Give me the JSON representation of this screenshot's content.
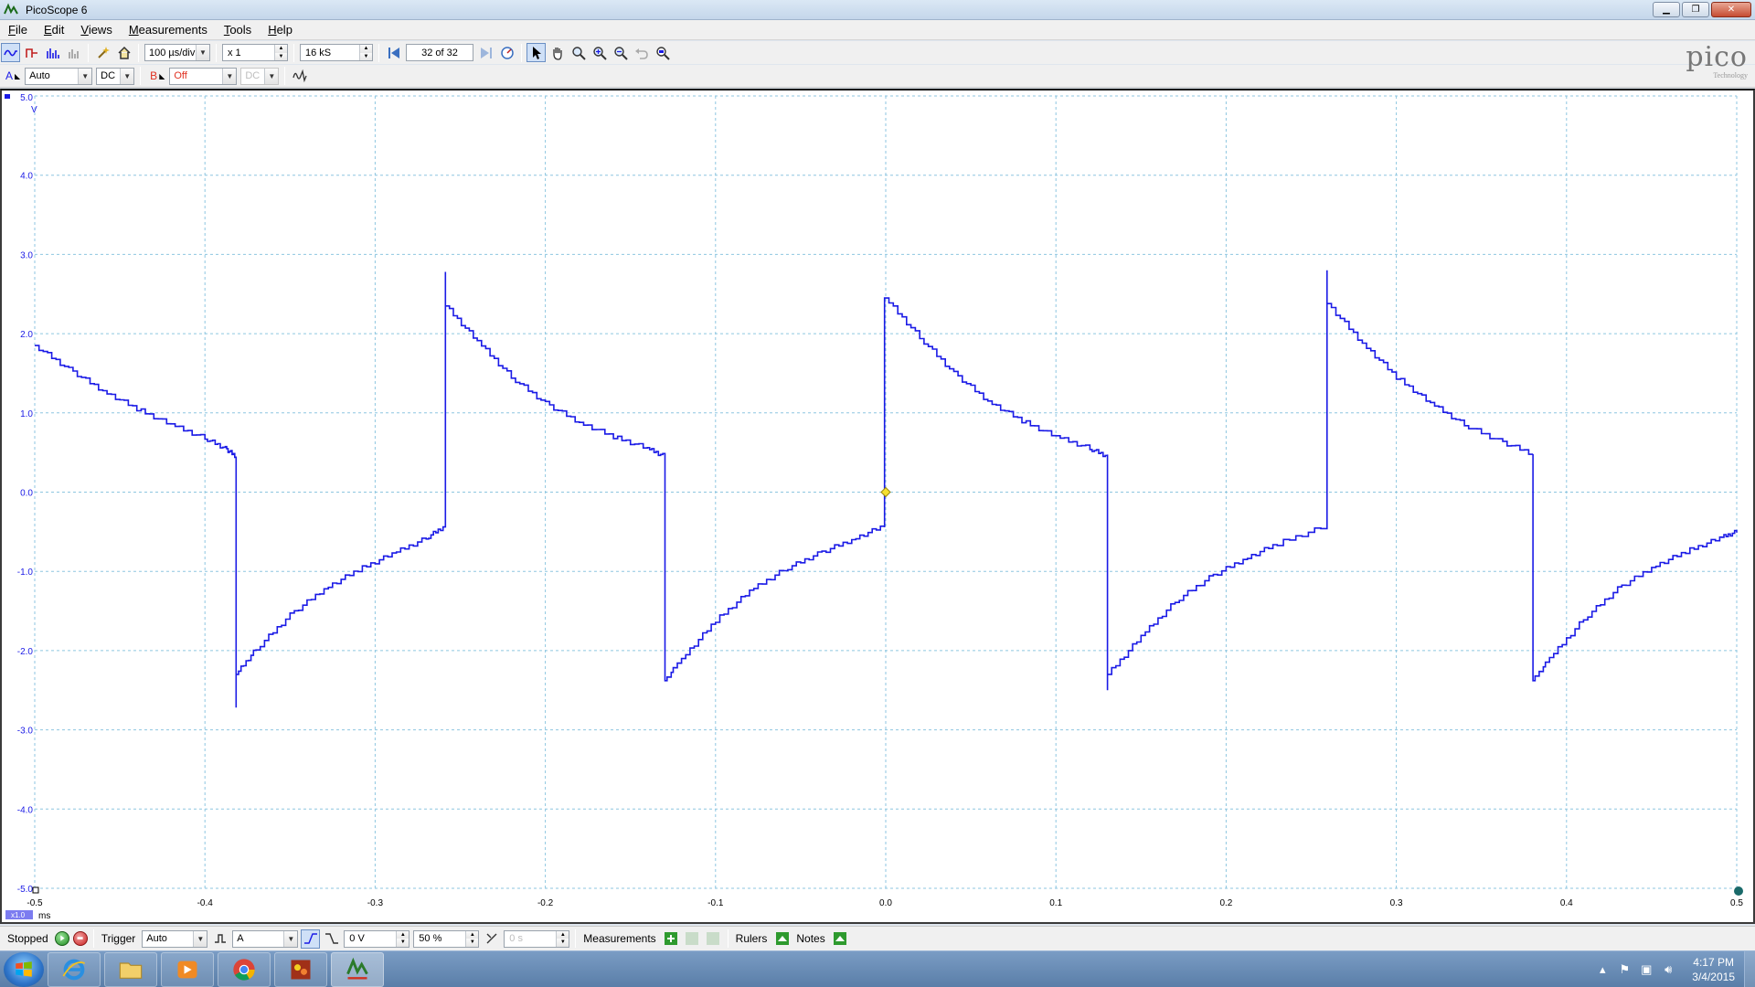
{
  "window": {
    "title": "PicoScope 6"
  },
  "menu": [
    {
      "key": "F",
      "rest": "ile"
    },
    {
      "key": "E",
      "rest": "dit"
    },
    {
      "key": "V",
      "rest": "iews"
    },
    {
      "key": "M",
      "rest": "easurements"
    },
    {
      "key": "T",
      "rest": "ools"
    },
    {
      "key": "H",
      "rest": "elp"
    }
  ],
  "toolbar": {
    "timebase": "100 µs/div",
    "zoom": "x 1",
    "samples": "16 kS",
    "buffer": "32 of 32"
  },
  "channels": {
    "a": {
      "label": "A",
      "range": "Auto",
      "coupling": "DC",
      "color": "#1a1ae6"
    },
    "b": {
      "label": "B",
      "range": "Off",
      "coupling": "DC",
      "color": "#e03020"
    }
  },
  "logo": {
    "word": "pico",
    "sub": "Technology"
  },
  "axes": {
    "y_unit": "V",
    "x_unit": "ms",
    "x_zoom": "x1.0",
    "y_ticks": [
      "5.0",
      "4.0",
      "3.0",
      "2.0",
      "1.0",
      "0.0",
      "-1.0",
      "-2.0",
      "-3.0",
      "-4.0",
      "-5.0"
    ],
    "x_ticks": [
      "-0.5",
      "-0.4",
      "-0.3",
      "-0.2",
      "-0.1",
      "0.0",
      "0.1",
      "0.2",
      "0.3",
      "0.4",
      "0.5"
    ]
  },
  "chart_data": {
    "type": "line",
    "xlabel": "ms",
    "ylabel": "V",
    "xlim": [
      -0.5,
      0.5
    ],
    "ylim": [
      -5.0,
      5.0
    ],
    "grid": true,
    "series": [
      {
        "name": "A",
        "color": "#1a1ae6",
        "points": [
          [
            -0.5,
            1.85
          ],
          [
            -0.48,
            1.55
          ],
          [
            -0.46,
            1.28
          ],
          [
            -0.44,
            1.05
          ],
          [
            -0.42,
            0.85
          ],
          [
            -0.4,
            0.68
          ],
          [
            -0.388,
            0.55
          ],
          [
            -0.3817,
            0.45
          ],
          [
            -0.3817,
            -2.72
          ],
          [
            -0.3817,
            -2.3
          ],
          [
            -0.37,
            -1.98
          ],
          [
            -0.35,
            -1.55
          ],
          [
            -0.33,
            -1.22
          ],
          [
            -0.31,
            -0.98
          ],
          [
            -0.29,
            -0.78
          ],
          [
            -0.27,
            -0.58
          ],
          [
            -0.2587,
            -0.42
          ],
          [
            -0.2587,
            2.78
          ],
          [
            -0.2587,
            2.35
          ],
          [
            -0.24,
            1.9
          ],
          [
            -0.22,
            1.45
          ],
          [
            -0.2,
            1.12
          ],
          [
            -0.18,
            0.88
          ],
          [
            -0.16,
            0.7
          ],
          [
            -0.14,
            0.55
          ],
          [
            -0.1297,
            0.45
          ],
          [
            -0.1297,
            -2.38
          ],
          [
            -0.12,
            -2.1
          ],
          [
            -0.1,
            -1.62
          ],
          [
            -0.08,
            -1.25
          ],
          [
            -0.06,
            -0.98
          ],
          [
            -0.04,
            -0.78
          ],
          [
            -0.02,
            -0.6
          ],
          [
            -0.0007,
            -0.42
          ],
          [
            -0.0007,
            2.45
          ],
          [
            0.02,
            1.95
          ],
          [
            0.04,
            1.5
          ],
          [
            0.06,
            1.15
          ],
          [
            0.08,
            0.9
          ],
          [
            0.1,
            0.7
          ],
          [
            0.12,
            0.55
          ],
          [
            0.1303,
            0.45
          ],
          [
            0.1303,
            -2.5
          ],
          [
            0.1303,
            -2.3
          ],
          [
            0.15,
            -1.82
          ],
          [
            0.17,
            -1.38
          ],
          [
            0.19,
            -1.08
          ],
          [
            0.21,
            -0.85
          ],
          [
            0.23,
            -0.65
          ],
          [
            0.2593,
            -0.42
          ],
          [
            0.2593,
            2.8
          ],
          [
            0.2593,
            2.38
          ],
          [
            0.28,
            1.88
          ],
          [
            0.3,
            1.45
          ],
          [
            0.32,
            1.12
          ],
          [
            0.34,
            0.85
          ],
          [
            0.36,
            0.65
          ],
          [
            0.3803,
            0.48
          ],
          [
            0.3803,
            -2.38
          ],
          [
            0.39,
            -2.1
          ],
          [
            0.41,
            -1.6
          ],
          [
            0.43,
            -1.22
          ],
          [
            0.45,
            -0.95
          ],
          [
            0.47,
            -0.75
          ],
          [
            0.49,
            -0.58
          ],
          [
            0.5,
            -0.5
          ]
        ]
      }
    ],
    "trigger_marker": [
      0.0,
      0.0
    ]
  },
  "status": {
    "state": "Stopped",
    "trigger_label": "Trigger",
    "trigger_mode": "Auto",
    "trigger_source": "A",
    "trigger_level": "0 V",
    "pretrigger": "50 %",
    "delay": "0 s",
    "measurements_label": "Measurements",
    "rulers_label": "Rulers",
    "notes_label": "Notes"
  },
  "taskbar": {
    "time": "4:17 PM",
    "date": "3/4/2015"
  }
}
